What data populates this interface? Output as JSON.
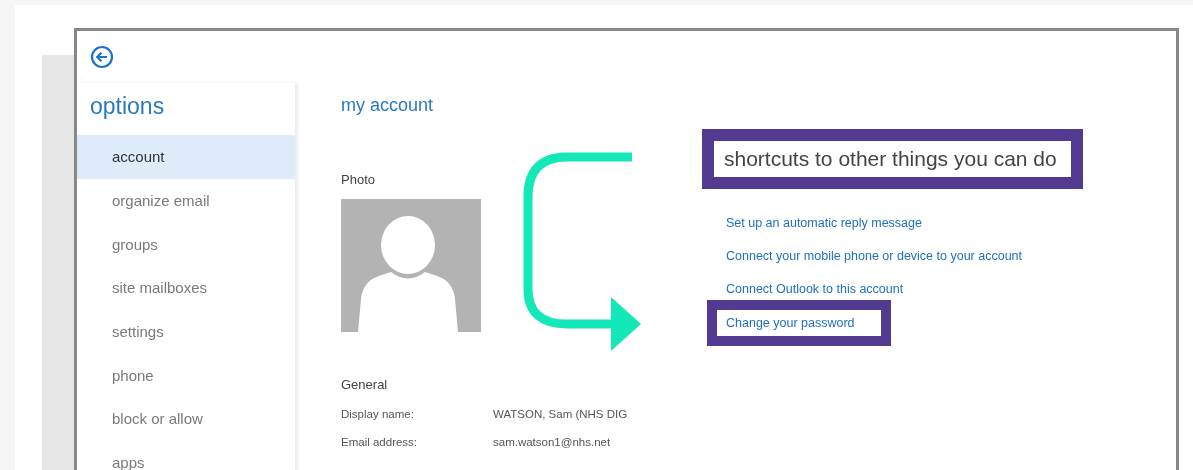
{
  "sidebar": {
    "title": "options",
    "items": [
      {
        "label": "account",
        "selected": true
      },
      {
        "label": "organize email",
        "selected": false
      },
      {
        "label": "groups",
        "selected": false
      },
      {
        "label": "site mailboxes",
        "selected": false
      },
      {
        "label": "settings",
        "selected": false
      },
      {
        "label": "phone",
        "selected": false
      },
      {
        "label": "block or allow",
        "selected": false
      },
      {
        "label": "apps",
        "selected": false
      }
    ]
  },
  "content": {
    "title": "my account",
    "photo_label": "Photo",
    "general": {
      "heading": "General",
      "fields": [
        {
          "label": "Display name:",
          "value": "WATSON, Sam (NHS DIG"
        },
        {
          "label": "Email address:",
          "value": "sam.watson1@nhs.net"
        }
      ]
    },
    "shortcuts": {
      "heading": {
        "text": "shortcuts to other things you can do",
        "highlighted": true
      },
      "links": [
        {
          "label": "Set up an automatic reply message",
          "highlighted": false
        },
        {
          "label": "Connect your mobile phone or device to your account",
          "highlighted": false
        },
        {
          "label": "Connect Outlook to this account",
          "highlighted": false
        },
        {
          "label": "Change your password",
          "highlighted": true
        }
      ]
    }
  }
}
